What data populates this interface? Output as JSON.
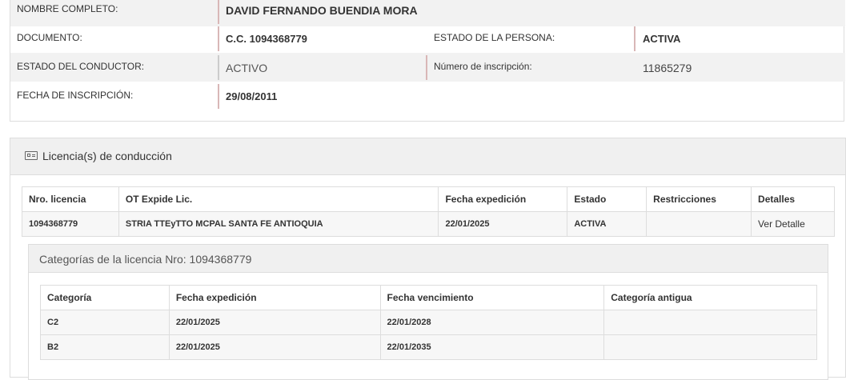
{
  "person": {
    "nombre_label": "NOMBRE COMPLETO:",
    "nombre_value": "DAVID FERNANDO BUENDIA MORA",
    "documento_label": "DOCUMENTO:",
    "documento_value": "C.C. 1094368779",
    "estado_persona_label": "ESTADO DE LA PERSONA:",
    "estado_persona_value": "ACTIVA",
    "estado_conductor_label": "ESTADO DEL CONDUCTOR:",
    "estado_conductor_value": "ACTIVO",
    "num_inscripcion_label": "Número de inscripción:",
    "num_inscripcion_value": "11865279",
    "fecha_inscripcion_label": "FECHA DE INSCRIPCIÓN:",
    "fecha_inscripcion_value": "29/08/2011"
  },
  "licenses": {
    "title": "Licencia(s) de conducción",
    "icon": "id-card-icon",
    "columns": [
      "Nro. licencia",
      "OT Expide Lic.",
      "Fecha expedición",
      "Estado",
      "Restricciones",
      "Detalles"
    ],
    "rows": [
      {
        "nro": "1094368779",
        "ot": "STRIA TTEyTTO MCPAL SANTA FE ANTIOQUIA",
        "fecha": "22/01/2025",
        "estado": "ACTIVA",
        "restricciones": "",
        "detalles": "Ver Detalle"
      }
    ]
  },
  "categories": {
    "title": "Categorías de la licencia Nro: 1094368779",
    "columns": [
      "Categoría",
      "Fecha expedición",
      "Fecha vencimiento",
      "Categoría antigua"
    ],
    "rows": [
      {
        "categoria": "C2",
        "expedicion": "22/01/2025",
        "vencimiento": "22/01/2028",
        "antigua": ""
      },
      {
        "categoria": "B2",
        "expedicion": "22/01/2025",
        "vencimiento": "22/01/2035",
        "antigua": ""
      }
    ]
  }
}
